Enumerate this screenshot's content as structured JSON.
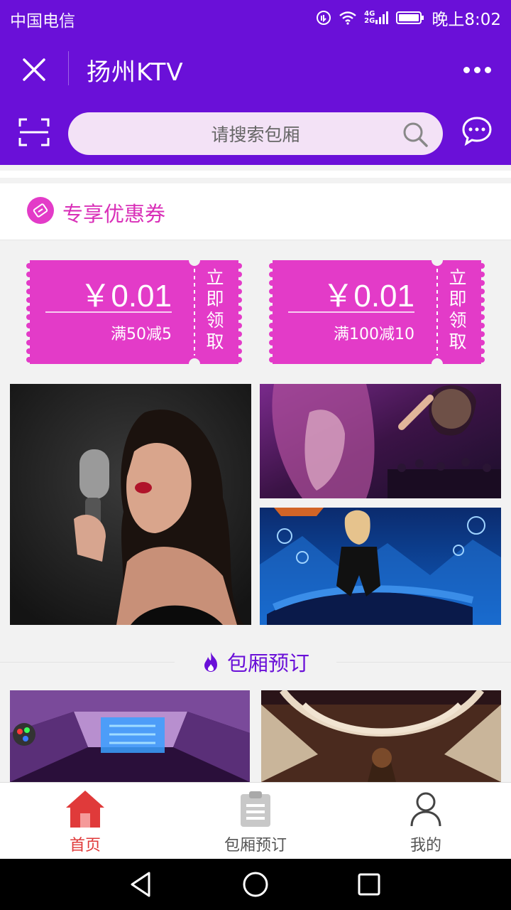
{
  "status_bar": {
    "carrier": "中国电信",
    "network": [
      "4G",
      "2G"
    ],
    "time": "晚上8:02"
  },
  "title_bar": {
    "title": "扬州KTV"
  },
  "search": {
    "placeholder": "请搜索包厢"
  },
  "coupon_section": {
    "title": "专享优惠券",
    "coupons": [
      {
        "amount": "￥0.01",
        "condition": "满50减5",
        "action": "立即领取"
      },
      {
        "amount": "￥0.01",
        "condition": "满100减10",
        "action": "立即领取"
      }
    ]
  },
  "colors": {
    "brand": "#6a10d8",
    "coupon": "#e33bc8",
    "active_tab": "#e03a3a"
  },
  "room_section": {
    "title": "包厢预订"
  },
  "bottom_nav": [
    {
      "label": "首页",
      "icon": "home-icon",
      "active": true
    },
    {
      "label": "包厢预订",
      "icon": "clipboard-icon",
      "active": false
    },
    {
      "label": "我的",
      "icon": "user-icon",
      "active": false
    }
  ]
}
